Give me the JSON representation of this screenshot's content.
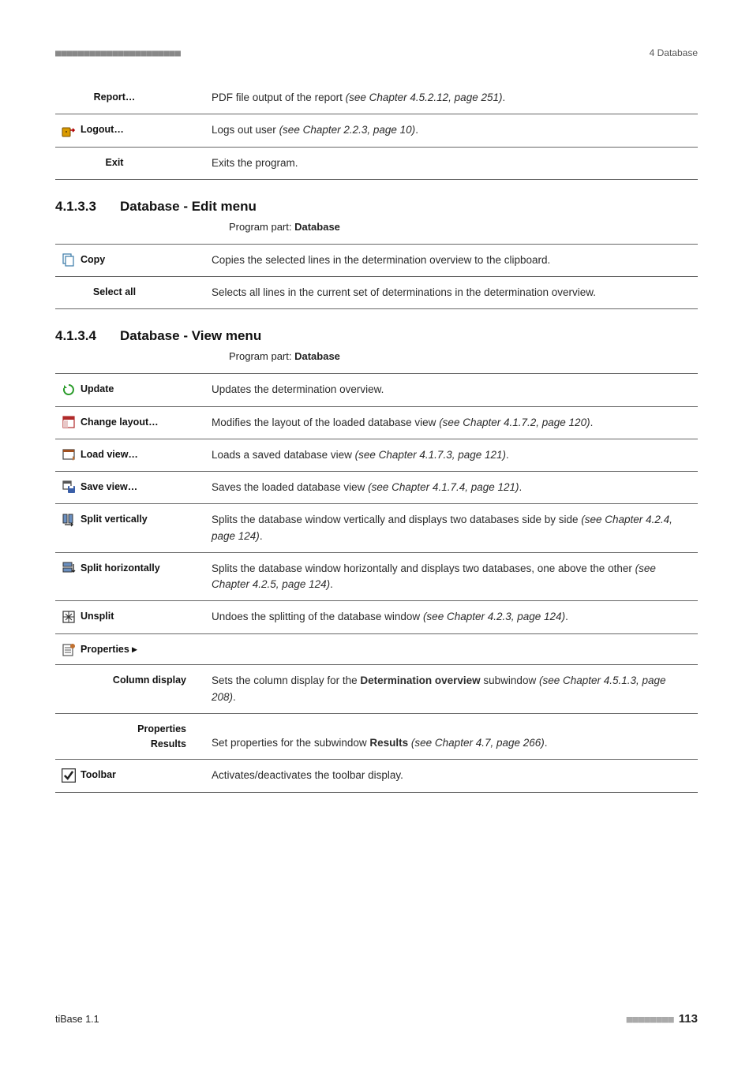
{
  "header": {
    "dashes": "■■■■■■■■■■■■■■■■■■■■■■",
    "chapter": "4 Database"
  },
  "tables": {
    "file": [
      {
        "label": "Report…",
        "desc": "PDF file output of the report ",
        "desc_ref": "(see Chapter 4.5.2.12, page 251)",
        "desc_after": "."
      },
      {
        "label": "Logout…",
        "desc": "Logs out user ",
        "desc_ref": "(see Chapter 2.2.3, page 10)",
        "desc_after": "."
      },
      {
        "label": "Exit",
        "desc": "Exits the program.",
        "desc_ref": "",
        "desc_after": ""
      }
    ],
    "edit": [
      {
        "label": "Copy",
        "desc": "Copies the selected lines in the determination overview to the clipboard.",
        "desc_ref": "",
        "desc_after": ""
      },
      {
        "label": "Select all",
        "desc": "Selects all lines in the current set of determinations in the determination overview.",
        "desc_ref": "",
        "desc_after": ""
      }
    ],
    "view": [
      {
        "label": "Update",
        "desc": "Updates the determination overview.",
        "desc_ref": "",
        "desc_after": ""
      },
      {
        "label": "Change layout…",
        "desc": "Modifies the layout of the loaded database view ",
        "desc_ref": "(see Chapter 4.1.7.2, page 120)",
        "desc_after": "."
      },
      {
        "label": "Load view…",
        "desc": "Loads a saved database view ",
        "desc_ref": "(see Chapter 4.1.7.3, page 121)",
        "desc_after": "."
      },
      {
        "label": "Save view…",
        "desc": "Saves the loaded database view ",
        "desc_ref": "(see Chapter 4.1.7.4, page 121)",
        "desc_after": "."
      },
      {
        "label": "Split vertically",
        "desc": "Splits the database window vertically and displays two databases side by side ",
        "desc_ref": "(see Chapter 4.2.4, page 124)",
        "desc_after": "."
      },
      {
        "label": "Split horizontally",
        "desc": "Splits the database window horizontally and displays two databases, one above the other ",
        "desc_ref": "(see Chapter 4.2.5, page 124)",
        "desc_after": "."
      },
      {
        "label": "Unsplit",
        "desc": "Undoes the splitting of the database window ",
        "desc_ref": "(see Chapter 4.2.3, page 124)",
        "desc_after": "."
      },
      {
        "label": "Properties ▸",
        "desc": "",
        "desc_ref": "",
        "desc_after": ""
      },
      {
        "label": "Column display",
        "desc_pre": "Sets the column display for the ",
        "desc_bold": "Determination overview",
        "desc_post": " subwindow ",
        "desc_ref": "(see Chapter 4.5.1.3, page 208)",
        "desc_after": "."
      },
      {
        "label": "Properties Results",
        "desc_pre": "Set properties for the subwindow ",
        "desc_bold": "Results",
        "desc_post": " ",
        "desc_ref": "(see Chapter 4.7, page 266)",
        "desc_after": "."
      },
      {
        "label": "Toolbar",
        "desc": "Activates/deactivates the toolbar display.",
        "desc_ref": "",
        "desc_after": ""
      }
    ]
  },
  "sections": {
    "edit": {
      "number": "4.1.3.3",
      "title": "Database - Edit menu",
      "program_part_label": "Program part: ",
      "program_part_bold": "Database"
    },
    "view": {
      "number": "4.1.3.4",
      "title": "Database - View menu",
      "program_part_label": "Program part: ",
      "program_part_bold": "Database"
    }
  },
  "footer": {
    "left": "tiBase 1.1",
    "dashes": "■■■■■■■■",
    "page": "113"
  }
}
